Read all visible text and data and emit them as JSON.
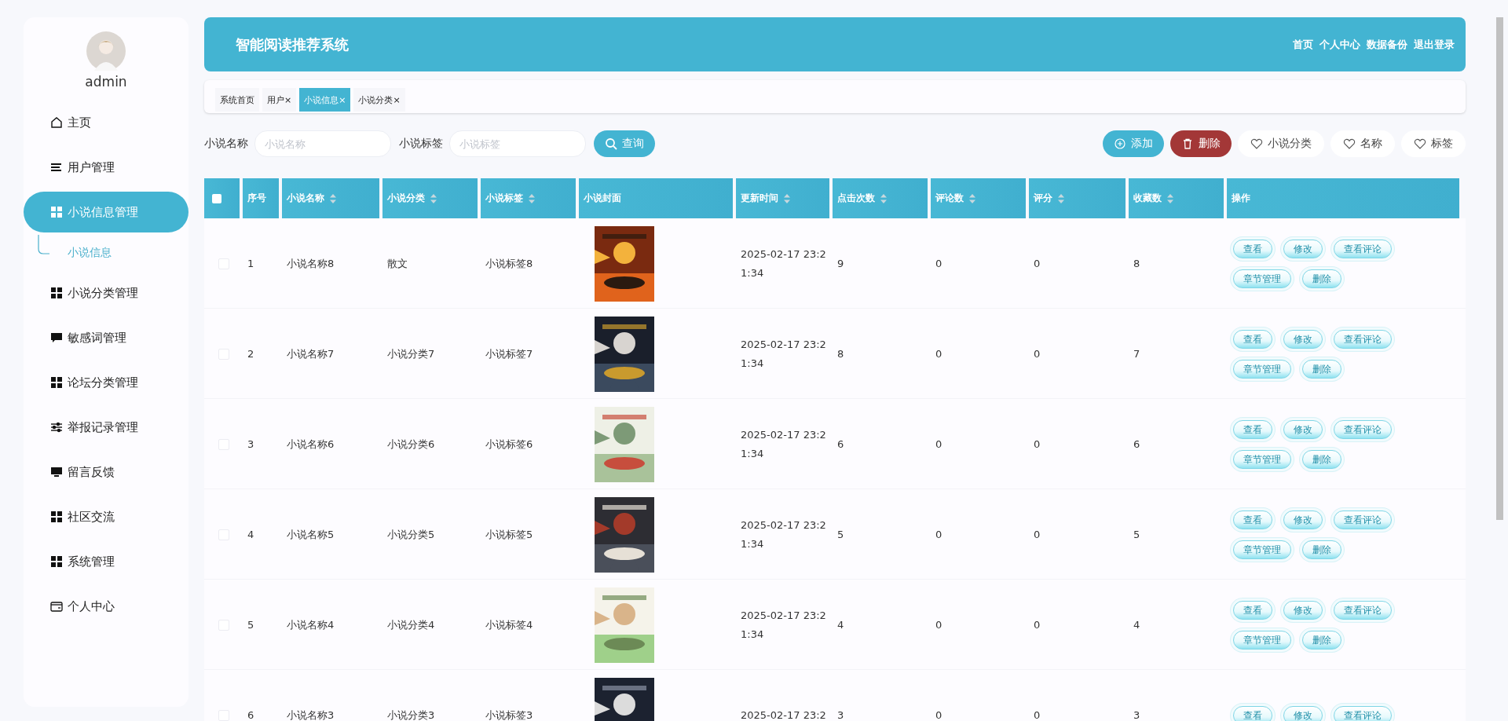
{
  "sidebar": {
    "user": {
      "name": "admin"
    },
    "items": [
      {
        "label": "主页",
        "selected": false
      },
      {
        "label": "用户管理",
        "selected": false
      },
      {
        "label": "小说信息管理",
        "selected": true,
        "expanded": true,
        "children": [
          {
            "label": "小说信息",
            "selected": true
          }
        ]
      },
      {
        "label": "小说分类管理",
        "selected": false
      },
      {
        "label": "敏感词管理",
        "selected": false
      },
      {
        "label": "论坛分类管理",
        "selected": false
      },
      {
        "label": "举报记录管理",
        "selected": false
      },
      {
        "label": "留言反馈",
        "selected": false
      },
      {
        "label": "社区交流",
        "selected": false
      },
      {
        "label": "系统管理",
        "selected": false
      },
      {
        "label": "个人中心",
        "selected": false
      }
    ]
  },
  "header": {
    "title": "智能阅读推荐系统",
    "links": [
      "首页",
      "个人中心",
      "数据备份",
      "退出登录"
    ]
  },
  "tabs": [
    {
      "label": "系统首页",
      "selected": false
    },
    {
      "label": "用户",
      "close": "×",
      "selected": false
    },
    {
      "label": "小说信息",
      "close": "×",
      "selected": true
    },
    {
      "label": "小说分类",
      "close": "×",
      "selected": false
    }
  ],
  "search": {
    "fields": [
      {
        "label": "小说名称",
        "placeholder": "小说名称"
      },
      {
        "label": "小说标签",
        "placeholder": "小说标签"
      }
    ],
    "button": "查询"
  },
  "toolbar": [
    {
      "label": "添加",
      "kind": "add"
    },
    {
      "label": "删除",
      "kind": "delete"
    },
    {
      "label": "小说分类",
      "kind": "filter"
    },
    {
      "label": "名称",
      "kind": "filter"
    },
    {
      "label": "标签",
      "kind": "filter"
    }
  ],
  "table": {
    "select_all": {
      "checked": false
    },
    "columns": [
      {
        "label": "序号",
        "sortable": false
      },
      {
        "label": "小说名称",
        "sortable": true
      },
      {
        "label": "小说分类",
        "sortable": true
      },
      {
        "label": "小说标签",
        "sortable": true
      },
      {
        "label": "小说封面",
        "sortable": false
      },
      {
        "label": "更新时间",
        "sortable": true
      },
      {
        "label": "点击次数",
        "sortable": true
      },
      {
        "label": "评论数",
        "sortable": true
      },
      {
        "label": "评分",
        "sortable": true
      },
      {
        "label": "收藏数",
        "sortable": true
      },
      {
        "label": "操作",
        "sortable": false
      }
    ],
    "rows": [
      {
        "checked": false,
        "cells": [
          "1",
          "小说名称8",
          "散文",
          "小说标签8"
        ],
        "cover": {
          "kind": "picture"
        },
        "time": "2025-02-17 23:21:34",
        "stats": [
          "9",
          "0",
          "0",
          "8"
        ],
        "actions": [
          "查看",
          "修改",
          "查看评论",
          "章节管理",
          "删除"
        ]
      },
      {
        "checked": false,
        "cells": [
          "2",
          "小说名称7",
          "小说分类7",
          "小说标签7"
        ],
        "cover": {
          "kind": "picture"
        },
        "time": "2025-02-17 23:21:34",
        "stats": [
          "8",
          "0",
          "0",
          "7"
        ],
        "actions": [
          "查看",
          "修改",
          "查看评论",
          "章节管理",
          "删除"
        ]
      },
      {
        "checked": false,
        "cells": [
          "3",
          "小说名称6",
          "小说分类6",
          "小说标签6"
        ],
        "cover": {
          "kind": "picture"
        },
        "time": "2025-02-17 23:21:34",
        "stats": [
          "6",
          "0",
          "0",
          "6"
        ],
        "actions": [
          "查看",
          "修改",
          "查看评论",
          "章节管理",
          "删除"
        ]
      },
      {
        "checked": false,
        "cells": [
          "4",
          "小说名称5",
          "小说分类5",
          "小说标签5"
        ],
        "cover": {
          "kind": "picture"
        },
        "time": "2025-02-17 23:21:34",
        "stats": [
          "5",
          "0",
          "0",
          "5"
        ],
        "actions": [
          "查看",
          "修改",
          "查看评论",
          "章节管理",
          "删除"
        ]
      },
      {
        "checked": false,
        "cells": [
          "5",
          "小说名称4",
          "小说分类4",
          "小说标签4"
        ],
        "cover": {
          "kind": "picture"
        },
        "time": "2025-02-17 23:21:34",
        "stats": [
          "4",
          "0",
          "0",
          "4"
        ],
        "actions": [
          "查看",
          "修改",
          "查看评论",
          "章节管理",
          "删除"
        ]
      },
      {
        "checked": false,
        "cells": [
          "6",
          "小说名称3",
          "小说分类3",
          "小说标签3"
        ],
        "cover": {
          "kind": "picture"
        },
        "time": "2025-02-17 23:2",
        "stats": [
          "3",
          "0",
          "0",
          "3"
        ],
        "actions": [
          "查看",
          "修改",
          "查看评论"
        ]
      }
    ]
  }
}
